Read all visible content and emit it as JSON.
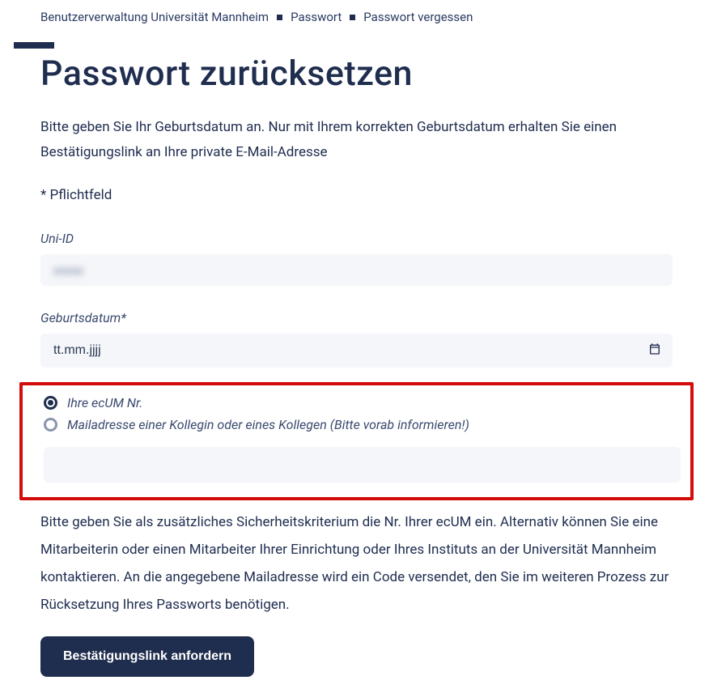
{
  "breadcrumb": {
    "item1": "Benutzerverwaltung Universität Mannheim",
    "item2": "Passwort",
    "item3": "Passwort vergessen"
  },
  "page": {
    "title": "Passwort zurücksetzen",
    "intro": "Bitte geben Sie Ihr Geburtsdatum an. Nur mit Ihrem korrekten Geburtsdatum erhalten Sie einen Bestätigungslink an Ihre private E-Mail-Adresse",
    "required_note": "* Pflichtfeld"
  },
  "fields": {
    "uni_id_label": "Uni-ID",
    "uni_id_value": "xxxxx",
    "dob_label": "Geburtsdatum*",
    "dob_placeholder": "tt.mm.jjjj"
  },
  "radio": {
    "option1": "Ihre ecUM Nr.",
    "option2": "Mailadresse einer Kollegin oder eines Kollegen (Bitte vorab informieren!)"
  },
  "help": {
    "text": "Bitte geben Sie als zusätzliches Sicherheitskriterium die Nr. Ihrer ecUM ein. Alternativ können Sie eine Mitarbeiterin oder einen Mitarbeiter Ihrer Einrichtung oder Ihres Instituts an der Universität Mannheim kontaktieren. An die angegebene Mailadresse wird ein Code versendet, den Sie im weiteren Prozess zur Rücksetzung Ihres Passworts benötigen."
  },
  "actions": {
    "submit": "Bestätigungslink anfordern"
  }
}
